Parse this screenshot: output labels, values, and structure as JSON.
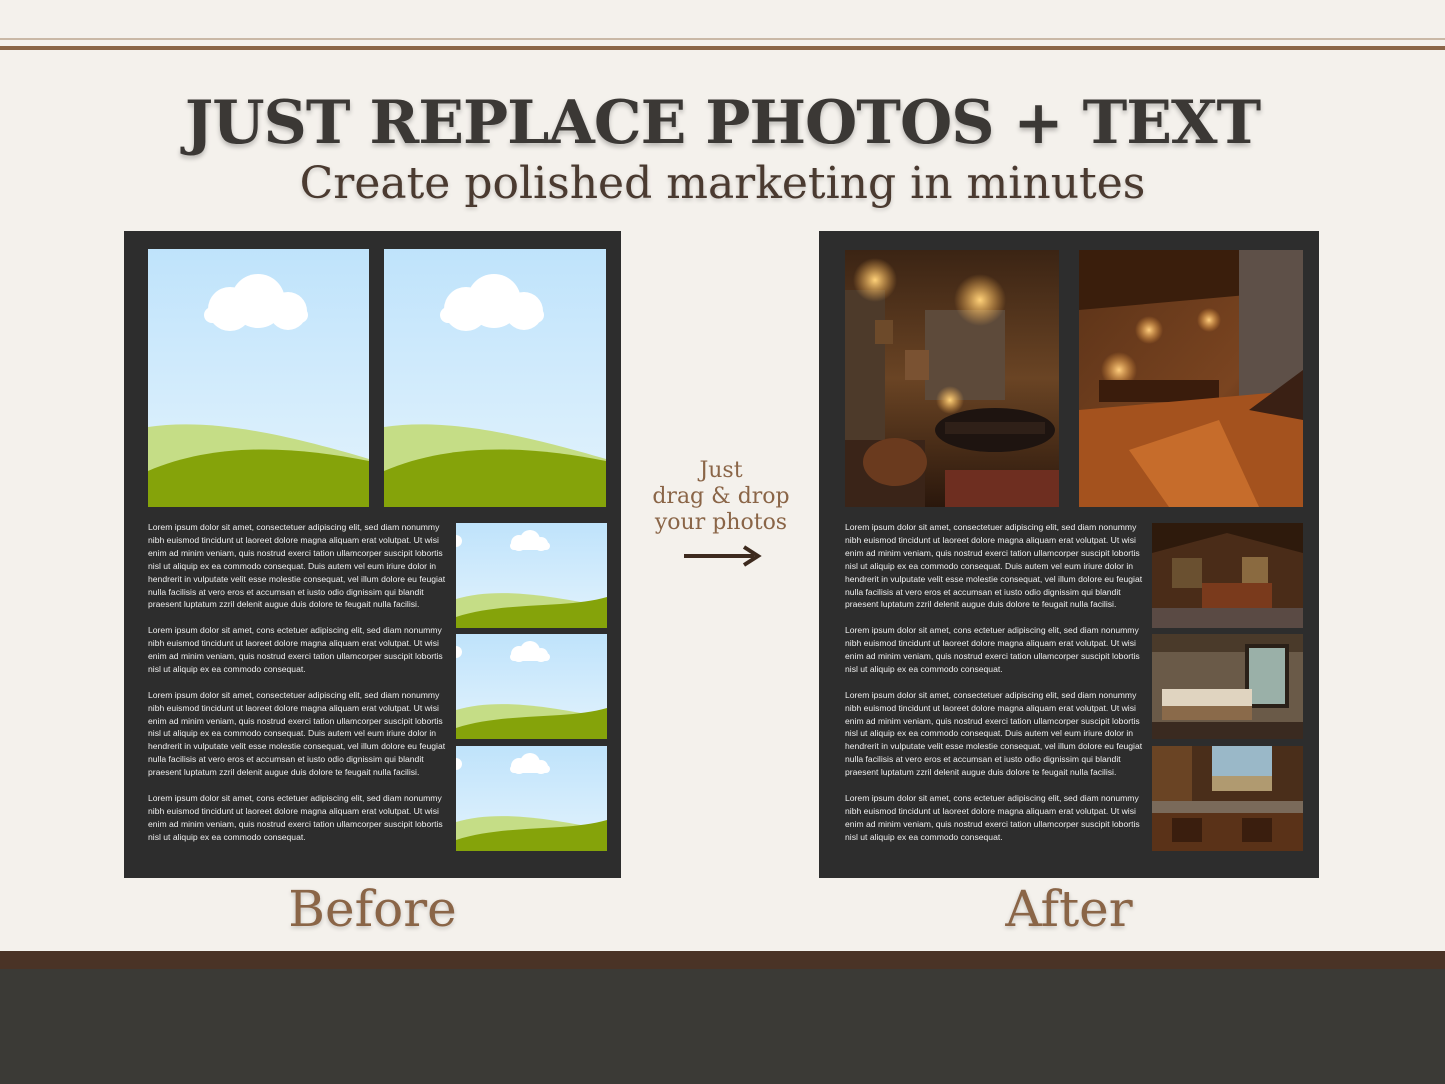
{
  "header": {
    "title": "JUST REPLACE PHOTOS + TEXT",
    "subtitle": "Create polished marketing in minutes"
  },
  "labels": {
    "before": "Before",
    "after": "After"
  },
  "drag_note": {
    "line1": "Just",
    "line2": "drag & drop",
    "line3": "your photos"
  },
  "body_text": {
    "p1": "Lorem ipsum dolor sit amet, consectetuer adipiscing elit, sed diam nonummy nibh euismod tincidunt ut laoreet dolore magna aliquam erat volutpat. Ut wisi enim ad minim veniam, quis nostrud exerci tation ullamcorper suscipit lobortis nisl ut aliquip ex ea commodo consequat. Duis autem vel eum iriure dolor in hendrerit in vulputate velit esse molestie consequat, vel illum dolore eu feugiat nulla facilisis at vero eros et accumsan et iusto odio dignissim qui blandit praesent luptatum zzril delenit augue duis dolore te feugait nulla facilisi.",
    "p2": "Lorem ipsum dolor sit amet, cons ectetuer adipiscing elit, sed diam nonummy nibh euismod tincidunt ut laoreet dolore magna aliquam erat volutpat. Ut wisi enim ad minim veniam, quis nostrud exerci tation ullamcorper suscipit lobortis nisl ut aliquip ex ea commodo consequat.",
    "p3": "Lorem ipsum dolor sit amet, consectetuer adipiscing elit, sed diam nonummy nibh euismod tincidunt ut laoreet dolore magna aliquam erat volutpat. Ut wisi enim ad minim veniam, quis nostrud exerci tation ullamcorper suscipit lobortis nisl ut aliquip ex ea commodo consequat. Duis autem vel eum iriure dolor in hendrerit in vulputate velit esse molestie consequat, vel illum dolore eu feugiat nulla facilisis at vero eros et accumsan et iusto odio dignissim qui blandit praesent luptatum zzril delenit augue duis dolore te feugait nulla facilisi.",
    "p4": "Lorem ipsum dolor sit amet, cons ectetuer adipiscing elit, sed diam nonummy nibh euismod tincidunt ut laoreet dolore magna aliquam erat volutpat. Ut wisi enim ad minim veniam, quis nostrud exerci tation ullamcorper suscipit lobortis nisl ut aliquip ex ea commodo consequat."
  },
  "colors": {
    "background": "#f4f1ec",
    "panel": "#2d2d2d",
    "accent_brown": "#8a6547",
    "heading": "#3b3835",
    "footer": "#3b3a36"
  }
}
